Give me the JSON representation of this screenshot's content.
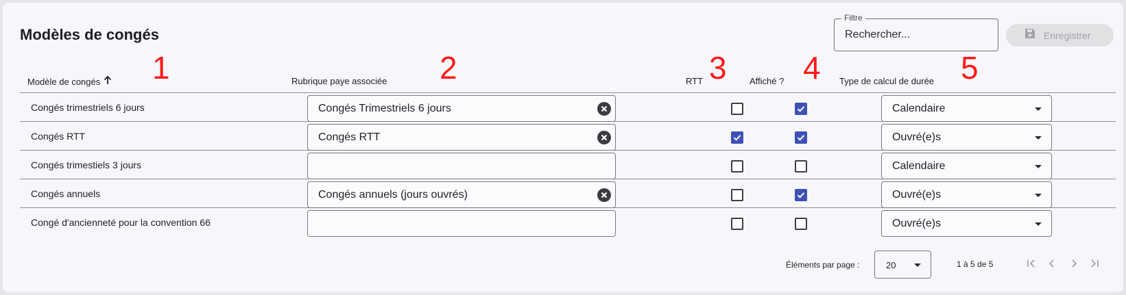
{
  "page": {
    "title": "Modèles de congés",
    "filter": {
      "label": "Filtre",
      "placeholder": "Rechercher..."
    },
    "save_label": "Enregistrer"
  },
  "annotations": [
    "1",
    "2",
    "3",
    "4",
    "5"
  ],
  "table": {
    "columns": {
      "modele": "Modèle de congés",
      "rubrique": "Rubrique paye associée",
      "rtt": "RTT",
      "affiche": "Affiché ?",
      "type_calcul": "Type de calcul de durée"
    },
    "sort": {
      "column": "modele",
      "direction": "ascending"
    },
    "rows": [
      {
        "modele": "Congés trimestriels 6 jours",
        "rubrique": "Congés Trimestriels 6 jours",
        "rtt": false,
        "affiche": true,
        "type_calcul": "Calendaire"
      },
      {
        "modele": "Congés RTT",
        "rubrique": "Congés RTT",
        "rtt": true,
        "affiche": true,
        "type_calcul": "Ouvré(e)s"
      },
      {
        "modele": "Congés trimestiels 3 jours",
        "rubrique": "",
        "rtt": false,
        "affiche": false,
        "type_calcul": "Calendaire"
      },
      {
        "modele": "Congés annuels",
        "rubrique": "Congés annuels (jours ouvrés)",
        "rtt": false,
        "affiche": true,
        "type_calcul": "Ouvré(e)s"
      },
      {
        "modele": "Congé d'ancienneté pour la convention 66",
        "rubrique": "",
        "rtt": false,
        "affiche": false,
        "type_calcul": "Ouvré(e)s"
      }
    ]
  },
  "pagination": {
    "items_per_page_label": "Éléments par page :",
    "items_per_page": "20",
    "range_label": "1 à 5 de 5"
  },
  "colors": {
    "accent": "#3f51b5",
    "annotation": "#ff1a1a"
  }
}
